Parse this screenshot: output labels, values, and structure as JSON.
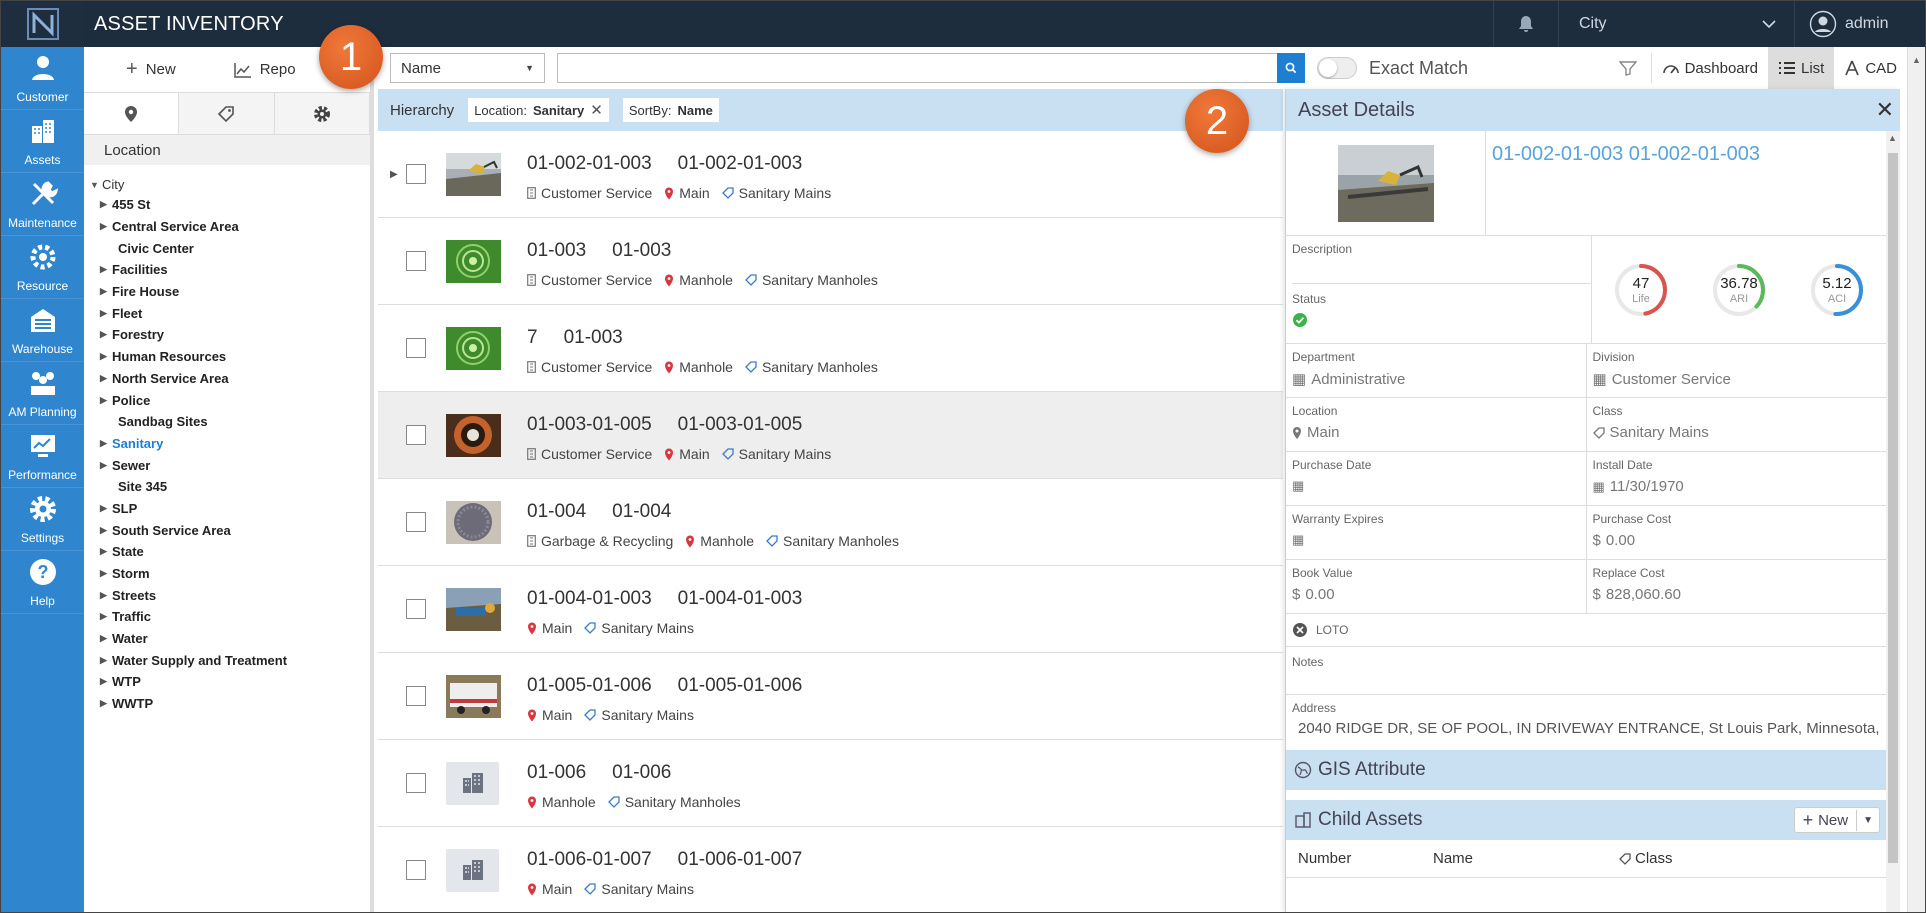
{
  "app": {
    "title": "ASSET INVENTORY"
  },
  "topbar": {
    "city_label": "City",
    "user_name": "admin"
  },
  "nav": [
    {
      "key": "customer",
      "label": "Customer",
      "icon": "customer-icon"
    },
    {
      "key": "assets",
      "label": "Assets",
      "icon": "assets-icon"
    },
    {
      "key": "maintenance",
      "label": "Maintenance",
      "icon": "maintenance-icon"
    },
    {
      "key": "resource",
      "label": "Resource",
      "icon": "resource-icon"
    },
    {
      "key": "warehouse",
      "label": "Warehouse",
      "icon": "warehouse-icon"
    },
    {
      "key": "amplanning",
      "label": "AM Planning",
      "icon": "am-planning-icon"
    },
    {
      "key": "performance",
      "label": "Performance",
      "icon": "performance-icon"
    },
    {
      "key": "settings",
      "label": "Settings",
      "icon": "settings-icon"
    },
    {
      "key": "help",
      "label": "Help",
      "icon": "help-icon"
    }
  ],
  "leftpanel": {
    "new_label": "New",
    "report_label": "Repo",
    "location_header": "Location",
    "tree_root": "City",
    "tree": [
      {
        "label": "455 St",
        "leaf": false
      },
      {
        "label": "Central Service Area",
        "leaf": false
      },
      {
        "label": "Civic Center",
        "leaf": true
      },
      {
        "label": "Facilities",
        "leaf": false
      },
      {
        "label": "Fire House",
        "leaf": false
      },
      {
        "label": "Fleet",
        "leaf": false
      },
      {
        "label": "Forestry",
        "leaf": false
      },
      {
        "label": "Human Resources",
        "leaf": false
      },
      {
        "label": "North Service Area",
        "leaf": false
      },
      {
        "label": "Police",
        "leaf": false
      },
      {
        "label": "Sandbag Sites",
        "leaf": true
      },
      {
        "label": "Sanitary",
        "leaf": false,
        "selected": true
      },
      {
        "label": "Sewer",
        "leaf": false
      },
      {
        "label": "Site 345",
        "leaf": true
      },
      {
        "label": "SLP",
        "leaf": false
      },
      {
        "label": "South Service Area",
        "leaf": false
      },
      {
        "label": "State",
        "leaf": false
      },
      {
        "label": "Storm",
        "leaf": false
      },
      {
        "label": "Streets",
        "leaf": false
      },
      {
        "label": "Traffic",
        "leaf": false
      },
      {
        "label": "Water",
        "leaf": false
      },
      {
        "label": "Water Supply and Treatment",
        "leaf": false
      },
      {
        "label": "WTP",
        "leaf": false
      },
      {
        "label": "WWTP",
        "leaf": false
      }
    ]
  },
  "search": {
    "field": "Name",
    "value": "",
    "exact_match_label": "Exact Match",
    "dashboard_label": "Dashboard",
    "list_label": "List",
    "cad_label": "CAD"
  },
  "filters": {
    "hierarchy_label": "Hierarchy",
    "chip1_key": "Location:",
    "chip1_val": "Sanitary",
    "chip2_key": "SortBy:",
    "chip2_val": "Name"
  },
  "rows": [
    {
      "id": "01-002-01-003",
      "name": "01-002-01-003",
      "dept": "Customer Service",
      "loc": "Main",
      "cls": "Sanitary Mains",
      "thumb": "excavator",
      "expander": true
    },
    {
      "id": "01-003",
      "name": "01-003",
      "dept": "Customer Service",
      "loc": "Manhole",
      "cls": "Sanitary Manholes",
      "thumb": "green"
    },
    {
      "id": "7",
      "name": "01-003",
      "dept": "Customer Service",
      "loc": "Manhole",
      "cls": "Sanitary Manholes",
      "thumb": "green"
    },
    {
      "id": "01-003-01-005",
      "name": "01-003-01-005",
      "dept": "Customer Service",
      "loc": "Main",
      "cls": "Sanitary Mains",
      "thumb": "pipe",
      "highlight": true
    },
    {
      "id": "01-004",
      "name": "01-004",
      "dept": "Garbage & Recycling",
      "loc": "Manhole",
      "cls": "Sanitary Manholes",
      "thumb": "cover"
    },
    {
      "id": "01-004-01-003",
      "name": "01-004-01-003",
      "dept": "",
      "loc": "Main",
      "cls": "Sanitary Mains",
      "thumb": "site"
    },
    {
      "id": "01-005-01-006",
      "name": "01-005-01-006",
      "dept": "",
      "loc": "Main",
      "cls": "Sanitary Mains",
      "thumb": "trailer"
    },
    {
      "id": "01-006",
      "name": "01-006",
      "dept": "",
      "loc": "Manhole",
      "cls": "Sanitary Manholes",
      "thumb": "building"
    },
    {
      "id": "01-006-01-007",
      "name": "01-006-01-007",
      "dept": "",
      "loc": "Main",
      "cls": "Sanitary Mains",
      "thumb": "building"
    }
  ],
  "details": {
    "header": "Asset Details",
    "title": "01-002-01-003 01-002-01-003",
    "description_label": "Description",
    "status_label": "Status",
    "gauges": [
      {
        "value": "47",
        "label": "Life",
        "color": "#d9534f",
        "fraction": 0.47
      },
      {
        "value": "36.78",
        "label": "ARI",
        "color": "#5cb85c",
        "fraction": 0.37
      },
      {
        "value": "5.12",
        "label": "ACI",
        "color": "#3a8fd9",
        "fraction": 0.51
      }
    ],
    "department_label": "Department",
    "department": "Administrative",
    "division_label": "Division",
    "division": "Customer Service",
    "location_label": "Location",
    "location": "Main",
    "class_label": "Class",
    "class": "Sanitary Mains",
    "purchase_date_label": "Purchase Date",
    "install_date_label": "Install Date",
    "install_date": "11/30/1970",
    "warranty_label": "Warranty Expires",
    "purchase_cost_label": "Purchase Cost",
    "purchase_cost": "0.00",
    "book_value_label": "Book Value",
    "book_value": "0.00",
    "replace_cost_label": "Replace Cost",
    "replace_cost": "828,060.60",
    "loto_label": "LOTO",
    "notes_label": "Notes",
    "address_label": "Address",
    "address": "2040 RIDGE DR, SE OF POOL, IN DRIVEWAY ENTRANCE, St Louis Park, Minnesota, ...",
    "gis_label": "GIS Attribute",
    "child_label": "Child Assets",
    "child_new": "New",
    "col_number": "Number",
    "col_name": "Name",
    "col_class": "Class"
  },
  "callouts": [
    "1",
    "2"
  ],
  "colors": {
    "nav": "#2f86cf",
    "topbar": "#1d2d3d",
    "accent": "#1e7fd1",
    "panel_header": "#c9dff2",
    "callout": "#e0612a"
  }
}
